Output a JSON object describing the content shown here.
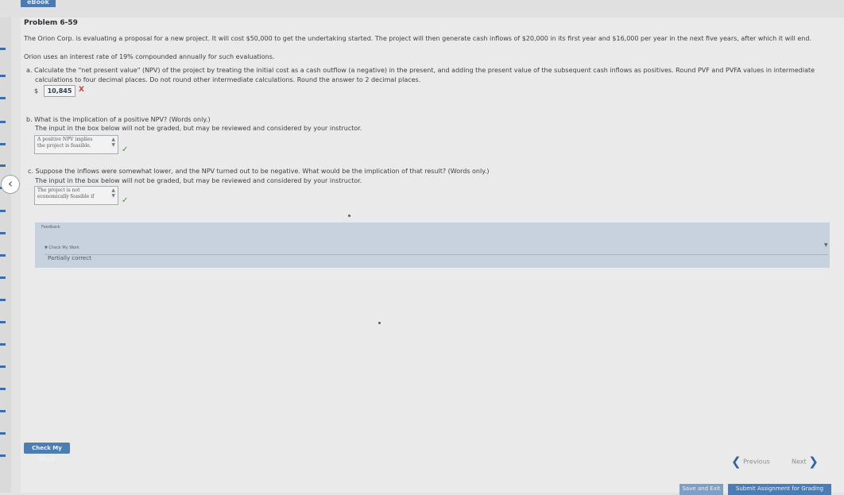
{
  "app": {
    "brand": "eBook"
  },
  "problem": {
    "title": "Problem 6-59",
    "intro_line1": "The Orion Corp. is evaluating a proposal for a new project. It will cost $50,000 to get the undertaking started. The project will then generate cash inflows of $20,000 in its first year and $16,000 per year in the next five years, after which it will end.",
    "intro_line2": "Orion uses an interest rate of 19% compounded annually for such evaluations."
  },
  "part_a": {
    "line1": "a. Calculate the \"net present value\" (NPV) of the project by treating the initial cost as a cash outflow (a negative) in the present, and adding the present value of the subsequent cash inflows as positives. Round PVF and PVFA values in intermediate",
    "line2": "calculations to four decimal places. Do not round other intermediate calculations. Round the answer to 2 decimal places.",
    "currency": "$",
    "answer": "10,845",
    "status_mark": "X"
  },
  "part_b": {
    "question": "b. What is the implication of a positive NPV? (Words only.)",
    "note": "The input in the box below will not be graded, but may be reviewed and considered by your instructor.",
    "answer_line1": "A positive NPV implies",
    "answer_line2": "the project is feasible.",
    "status_mark": "✓"
  },
  "part_c": {
    "question": "c. Suppose the inflows were somewhat lower, and the NPV turned out to be negative. What would be the implication of that result? (Words only.)",
    "note": "The input in the box below will not be graded, but may be reviewed and considered by your instructor.",
    "answer_line1": "The project is not",
    "answer_line2": "economically feasible if",
    "status_mark": "✓"
  },
  "feedback": {
    "label": "Feedback",
    "check_my_work": "▼ Check My Work",
    "result": "Partially correct"
  },
  "footer": {
    "check_my_work_button": "Check My Work",
    "previous": "Previous",
    "next": "Next",
    "save_exit": "Save and Exit",
    "submit": "Submit Assignment for Grading"
  },
  "colors": {
    "accent": "#4d7eb3",
    "incorrect": "#c2463c",
    "correct": "#4e8a3d",
    "feedback_bg": "#c7d2de"
  },
  "icons": [
    "back-chevron-icon",
    "dropdown-arrow-icon",
    "check-icon",
    "x-icon",
    "prev-chevron-icon",
    "next-chevron-icon"
  ]
}
